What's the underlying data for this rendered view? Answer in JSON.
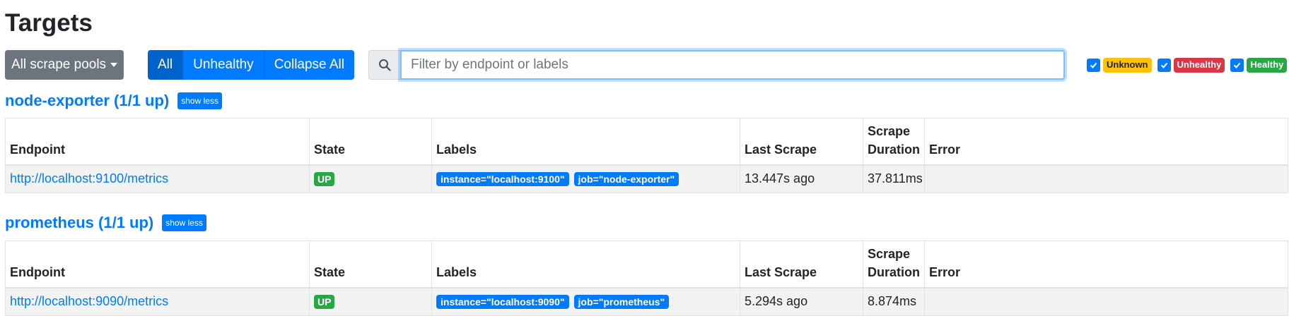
{
  "page": {
    "title": "Targets"
  },
  "toolbar": {
    "pools_label": "All scrape pools",
    "btn_all": "All",
    "btn_unhealthy": "Unhealthy",
    "btn_collapse": "Collapse All",
    "search_placeholder": "Filter by endpoint or labels",
    "search_value": ""
  },
  "filters": {
    "unknown": {
      "label": "Unknown",
      "checked": true,
      "color": "#ffc107"
    },
    "unhealthy": {
      "label": "Unhealthy",
      "checked": true,
      "color": "#dc3545"
    },
    "healthy": {
      "label": "Healthy",
      "checked": true,
      "color": "#28a745"
    }
  },
  "columns": {
    "endpoint": "Endpoint",
    "state": "State",
    "labels": "Labels",
    "last_scrape": "Last Scrape",
    "duration_line1": "Scrape",
    "duration_line2": "Duration",
    "error": "Error"
  },
  "pools": [
    {
      "title": "node-exporter (1/1 up)",
      "toggle": "show less",
      "rows": [
        {
          "endpoint": "http://localhost:9100/metrics",
          "state": "UP",
          "labels": [
            "instance=\"localhost:9100\"",
            "job=\"node-exporter\""
          ],
          "last_scrape": "13.447s ago",
          "duration": "37.811ms",
          "error": ""
        }
      ]
    },
    {
      "title": "prometheus (1/1 up)",
      "toggle": "show less",
      "rows": [
        {
          "endpoint": "http://localhost:9090/metrics",
          "state": "UP",
          "labels": [
            "instance=\"localhost:9090\"",
            "job=\"prometheus\""
          ],
          "last_scrape": "5.294s ago",
          "duration": "8.874ms",
          "error": ""
        }
      ]
    }
  ],
  "colors": {
    "primary": "#007bff",
    "secondary": "#6c757d",
    "success": "#28a745"
  }
}
